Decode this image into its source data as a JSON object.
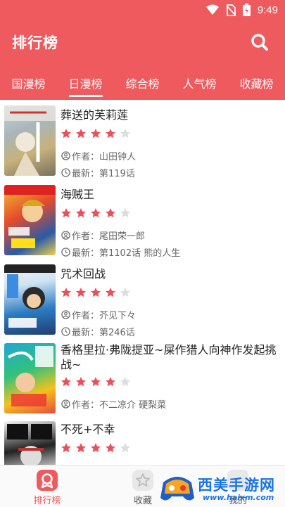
{
  "status_bar": {
    "time": "9:49"
  },
  "header": {
    "title": "排行榜"
  },
  "tabs": [
    {
      "label": "国漫榜"
    },
    {
      "label": "日漫榜"
    },
    {
      "label": "综合榜"
    },
    {
      "label": "人气榜"
    },
    {
      "label": "收藏榜"
    }
  ],
  "active_tab": "日漫榜",
  "items": [
    {
      "title": "葬送的芙莉莲",
      "rating": 4,
      "author": "作者：山田钟人",
      "latest": "最新：第119话"
    },
    {
      "title": "海贼王",
      "rating": 4,
      "author": "作者：尾田荣一郎",
      "latest": "最新：第1102话 熊的人生"
    },
    {
      "title": "咒术回战",
      "rating": 4,
      "author": "作者：芥见下々",
      "latest": "最新：第246话"
    },
    {
      "title": "香格里拉·弗陇提亚~屎作猎人向神作发起挑战~",
      "rating": 4,
      "author": "作者：不二凉介 硬梨菜",
      "latest": ""
    },
    {
      "title": "不死+不幸",
      "rating": 4,
      "author": "",
      "latest": ""
    }
  ],
  "bottom_nav": [
    {
      "label": "排行榜"
    },
    {
      "label": "收藏"
    },
    {
      "label": "我的"
    }
  ],
  "watermark": {
    "text": "西美手游网",
    "url": "www.haixm.com"
  },
  "colors": {
    "accent": "#ef5a5e",
    "star_on": "#e8515a",
    "star_off": "#dddddd"
  }
}
